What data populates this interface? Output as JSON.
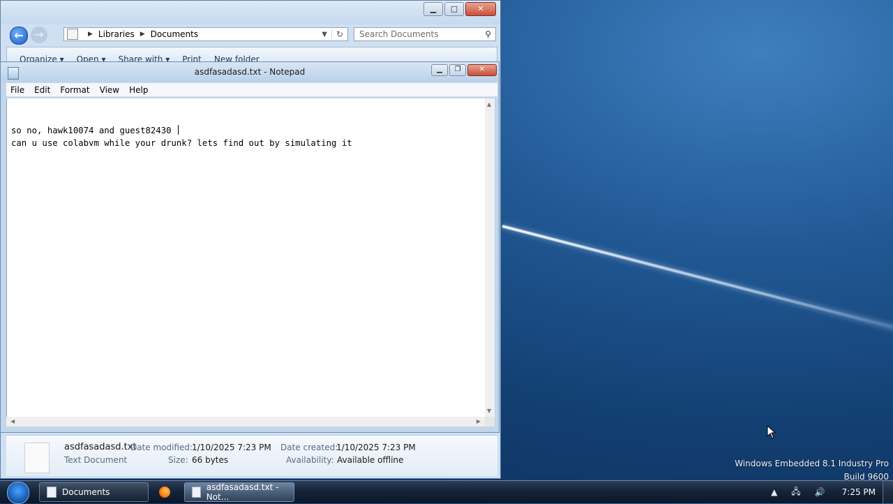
{
  "explorer": {
    "breadcrumb": [
      "Libraries",
      "Documents"
    ],
    "search_placeholder": "Search Documents",
    "toolbar": [
      "Organize ▾",
      "Open ▾",
      "Share with ▾",
      "Print",
      "New folder"
    ],
    "details": {
      "filename": "asdfasadasd.txt",
      "type": "Text Document",
      "date_modified_label": "Date modified:",
      "date_modified": "1/10/2025 7:23 PM",
      "size_label": "Size:",
      "size": "66 bytes",
      "date_created_label": "Date created:",
      "date_created": "1/10/2025 7:23 PM",
      "availability_label": "Availability:",
      "availability": "Available offline"
    }
  },
  "notepad": {
    "title": "asdfasadasd.txt - Notepad",
    "menu": [
      "File",
      "Edit",
      "Format",
      "View",
      "Help"
    ],
    "lines": [
      "so no, hawk10074 and guest82430 ",
      "can u use colabvm while your drunk? lets find out by simulating it"
    ]
  },
  "desktop": {
    "os_name": "Windows Embedded 8.1 Industry Pro",
    "build": "Build 9600"
  },
  "taskbar": {
    "buttons": [
      "Documents",
      "asdfasadasd.txt - Not..."
    ],
    "clock": "7:25 PM"
  },
  "icons": {
    "back": "back-arrow-icon",
    "forward": "forward-arrow-icon",
    "search": "search-icon",
    "refresh": "refresh-icon",
    "start": "windows-orb-icon",
    "firefox": "firefox-icon",
    "network": "network-icon",
    "volume": "volume-icon",
    "tray_arrow": "chevron-up-icon"
  }
}
